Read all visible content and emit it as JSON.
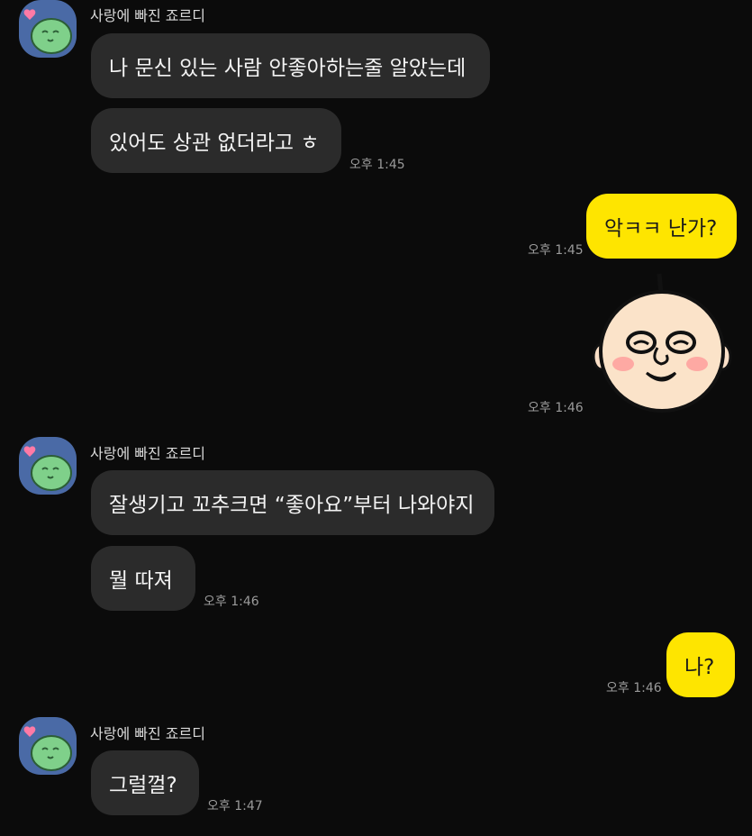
{
  "sender_name": "사랑에 빠진 죠르디",
  "messages": [
    {
      "text": "나 문신 있는 사람 안좋아하는줄 알았는데"
    },
    {
      "text": "있어도 상관 없더라고 ㅎ",
      "time": "오후 1:45"
    },
    {
      "text": "악ㅋㅋ 난가?",
      "time": "오후 1:45"
    },
    {
      "sticker": "bald-face-sticker",
      "time": "오후 1:46"
    },
    {
      "text": "잘생기고 꼬추크면 “좋아요”부터 나와야지"
    },
    {
      "text": "뭘 따져",
      "time": "오후 1:46"
    },
    {
      "text": "나?",
      "time": "오후 1:46"
    },
    {
      "text": "그럴껄?",
      "time": "오후 1:47"
    }
  ],
  "colors": {
    "background": "#0b0b0b",
    "incoming_bubble": "#2b2b2b",
    "outgoing_bubble": "#fee500",
    "avatar_bg": "#4a6aa6"
  },
  "icons": [
    "jordy-avatar-icon",
    "heart-icon"
  ]
}
